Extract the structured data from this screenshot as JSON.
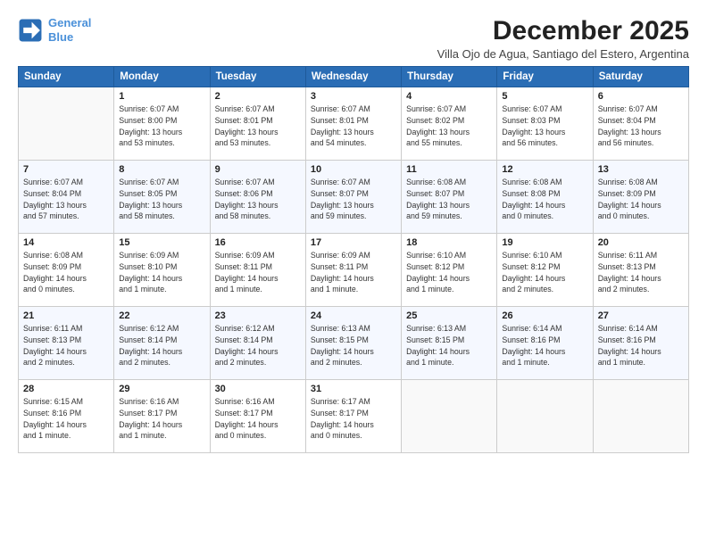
{
  "logo": {
    "line1": "General",
    "line2": "Blue"
  },
  "title": "December 2025",
  "subtitle": "Villa Ojo de Agua, Santiago del Estero, Argentina",
  "weekdays": [
    "Sunday",
    "Monday",
    "Tuesday",
    "Wednesday",
    "Thursday",
    "Friday",
    "Saturday"
  ],
  "weeks": [
    [
      {
        "day": "",
        "info": ""
      },
      {
        "day": "1",
        "info": "Sunrise: 6:07 AM\nSunset: 8:00 PM\nDaylight: 13 hours\nand 53 minutes."
      },
      {
        "day": "2",
        "info": "Sunrise: 6:07 AM\nSunset: 8:01 PM\nDaylight: 13 hours\nand 53 minutes."
      },
      {
        "day": "3",
        "info": "Sunrise: 6:07 AM\nSunset: 8:01 PM\nDaylight: 13 hours\nand 54 minutes."
      },
      {
        "day": "4",
        "info": "Sunrise: 6:07 AM\nSunset: 8:02 PM\nDaylight: 13 hours\nand 55 minutes."
      },
      {
        "day": "5",
        "info": "Sunrise: 6:07 AM\nSunset: 8:03 PM\nDaylight: 13 hours\nand 56 minutes."
      },
      {
        "day": "6",
        "info": "Sunrise: 6:07 AM\nSunset: 8:04 PM\nDaylight: 13 hours\nand 56 minutes."
      }
    ],
    [
      {
        "day": "7",
        "info": "Sunrise: 6:07 AM\nSunset: 8:04 PM\nDaylight: 13 hours\nand 57 minutes."
      },
      {
        "day": "8",
        "info": "Sunrise: 6:07 AM\nSunset: 8:05 PM\nDaylight: 13 hours\nand 58 minutes."
      },
      {
        "day": "9",
        "info": "Sunrise: 6:07 AM\nSunset: 8:06 PM\nDaylight: 13 hours\nand 58 minutes."
      },
      {
        "day": "10",
        "info": "Sunrise: 6:07 AM\nSunset: 8:07 PM\nDaylight: 13 hours\nand 59 minutes."
      },
      {
        "day": "11",
        "info": "Sunrise: 6:08 AM\nSunset: 8:07 PM\nDaylight: 13 hours\nand 59 minutes."
      },
      {
        "day": "12",
        "info": "Sunrise: 6:08 AM\nSunset: 8:08 PM\nDaylight: 14 hours\nand 0 minutes."
      },
      {
        "day": "13",
        "info": "Sunrise: 6:08 AM\nSunset: 8:09 PM\nDaylight: 14 hours\nand 0 minutes."
      }
    ],
    [
      {
        "day": "14",
        "info": "Sunrise: 6:08 AM\nSunset: 8:09 PM\nDaylight: 14 hours\nand 0 minutes."
      },
      {
        "day": "15",
        "info": "Sunrise: 6:09 AM\nSunset: 8:10 PM\nDaylight: 14 hours\nand 1 minute."
      },
      {
        "day": "16",
        "info": "Sunrise: 6:09 AM\nSunset: 8:11 PM\nDaylight: 14 hours\nand 1 minute."
      },
      {
        "day": "17",
        "info": "Sunrise: 6:09 AM\nSunset: 8:11 PM\nDaylight: 14 hours\nand 1 minute."
      },
      {
        "day": "18",
        "info": "Sunrise: 6:10 AM\nSunset: 8:12 PM\nDaylight: 14 hours\nand 1 minute."
      },
      {
        "day": "19",
        "info": "Sunrise: 6:10 AM\nSunset: 8:12 PM\nDaylight: 14 hours\nand 2 minutes."
      },
      {
        "day": "20",
        "info": "Sunrise: 6:11 AM\nSunset: 8:13 PM\nDaylight: 14 hours\nand 2 minutes."
      }
    ],
    [
      {
        "day": "21",
        "info": "Sunrise: 6:11 AM\nSunset: 8:13 PM\nDaylight: 14 hours\nand 2 minutes."
      },
      {
        "day": "22",
        "info": "Sunrise: 6:12 AM\nSunset: 8:14 PM\nDaylight: 14 hours\nand 2 minutes."
      },
      {
        "day": "23",
        "info": "Sunrise: 6:12 AM\nSunset: 8:14 PM\nDaylight: 14 hours\nand 2 minutes."
      },
      {
        "day": "24",
        "info": "Sunrise: 6:13 AM\nSunset: 8:15 PM\nDaylight: 14 hours\nand 2 minutes."
      },
      {
        "day": "25",
        "info": "Sunrise: 6:13 AM\nSunset: 8:15 PM\nDaylight: 14 hours\nand 1 minute."
      },
      {
        "day": "26",
        "info": "Sunrise: 6:14 AM\nSunset: 8:16 PM\nDaylight: 14 hours\nand 1 minute."
      },
      {
        "day": "27",
        "info": "Sunrise: 6:14 AM\nSunset: 8:16 PM\nDaylight: 14 hours\nand 1 minute."
      }
    ],
    [
      {
        "day": "28",
        "info": "Sunrise: 6:15 AM\nSunset: 8:16 PM\nDaylight: 14 hours\nand 1 minute."
      },
      {
        "day": "29",
        "info": "Sunrise: 6:16 AM\nSunset: 8:17 PM\nDaylight: 14 hours\nand 1 minute."
      },
      {
        "day": "30",
        "info": "Sunrise: 6:16 AM\nSunset: 8:17 PM\nDaylight: 14 hours\nand 0 minutes."
      },
      {
        "day": "31",
        "info": "Sunrise: 6:17 AM\nSunset: 8:17 PM\nDaylight: 14 hours\nand 0 minutes."
      },
      {
        "day": "",
        "info": ""
      },
      {
        "day": "",
        "info": ""
      },
      {
        "day": "",
        "info": ""
      }
    ]
  ]
}
